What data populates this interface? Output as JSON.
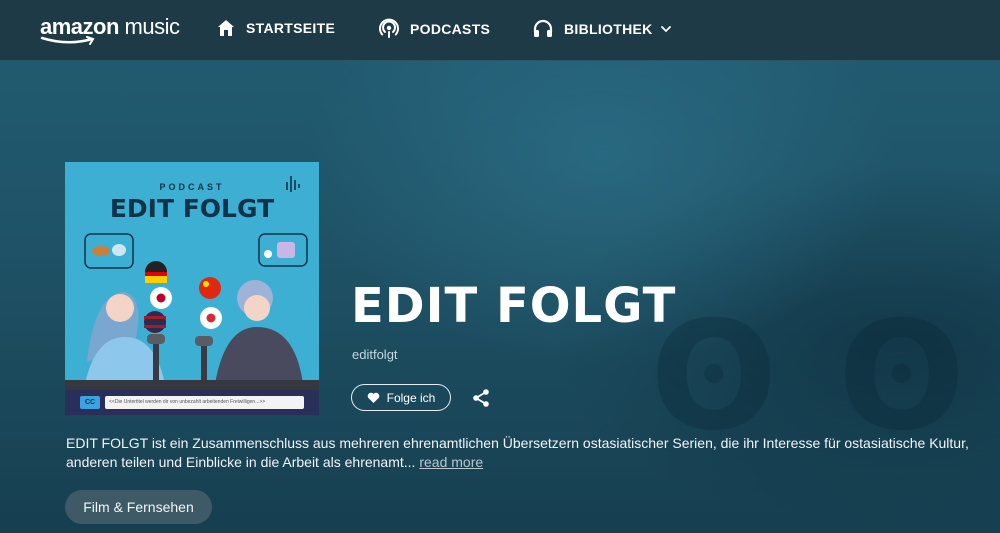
{
  "app": {
    "logo_brand": "amazon",
    "logo_product": "music"
  },
  "nav": {
    "items": [
      {
        "label": "STARTSEITE",
        "icon": "home-icon"
      },
      {
        "label": "PODCASTS",
        "icon": "podcast-icon"
      },
      {
        "label": "BIBLIOTHEK",
        "icon": "headphones-icon"
      }
    ]
  },
  "cover": {
    "eyebrow": "PODCAST",
    "title": "EDIT FOLGT",
    "subtitle_strip": "<<Die Untertitel werden dir von unbezahlt arbeitenden Freiwilligen...>>",
    "cc_badge": "CC"
  },
  "show": {
    "title": "EDIT FOLGT",
    "author": "editfolgt",
    "follow_label": "Folge ich",
    "description_line1": "EDIT FOLGT ist ein Zusammenschluss aus mehreren ehrenamtlichen Übersetzern ostasiatischer Serien, die ihr Interesse für ostasiatische Kultur,",
    "description_line2": "anderen teilen und Einblicke in die Arbeit als ehrenamt...",
    "read_more": "read more",
    "genre": "Film & Fernsehen"
  },
  "colors": {
    "nav_bg": "#1e3a47",
    "hero_bg": "#1f5266",
    "cover_bg": "#3dafd3",
    "chip_bg": "#3e5a66"
  }
}
